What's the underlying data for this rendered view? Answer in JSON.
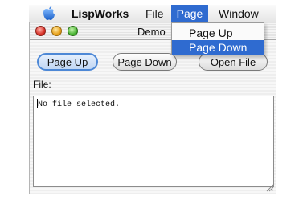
{
  "menubar": {
    "apple_icon": "apple-icon",
    "app_name": "LispWorks",
    "items": [
      "File",
      "Page",
      "Window"
    ]
  },
  "window": {
    "title": "Demo",
    "controls": [
      "close-icon",
      "minimize-icon",
      "zoom-icon"
    ],
    "buttons": {
      "page_up": "Page Up",
      "page_down": "Page Down",
      "open_file": "Open File"
    },
    "file_label": "File:",
    "text_content": "No file selected."
  },
  "dropdown": {
    "items": [
      "Page Up",
      "Page Down"
    ],
    "highlighted": "Page Down"
  },
  "colors": {
    "selection": "#2f6bd0",
    "default_button_border": "#4d88d6"
  }
}
